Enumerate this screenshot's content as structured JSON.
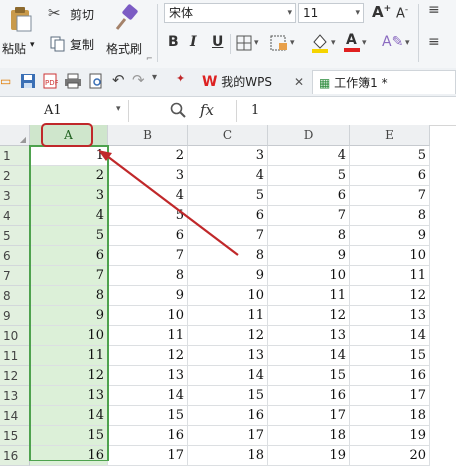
{
  "ribbon": {
    "cut_label": "剪切",
    "paste_label": "粘贴",
    "copy_label": "复制",
    "format_painter_label": "格式刷",
    "font_name": "宋体",
    "font_size": "11",
    "bold": "B",
    "italic": "I",
    "underline": "U"
  },
  "tabs": [
    {
      "label": "我的WPS"
    },
    {
      "label": "工作簿1 *"
    }
  ],
  "formula_bar": {
    "name_box": "A1",
    "fx_label": "fx",
    "value": "1"
  },
  "columns": [
    "A",
    "B",
    "C",
    "D",
    "E"
  ],
  "rows": [
    {
      "num": "1",
      "cells": [
        "1",
        "2",
        "3",
        "4",
        "5"
      ]
    },
    {
      "num": "2",
      "cells": [
        "2",
        "3",
        "4",
        "5",
        "6"
      ]
    },
    {
      "num": "3",
      "cells": [
        "3",
        "4",
        "5",
        "6",
        "7"
      ]
    },
    {
      "num": "4",
      "cells": [
        "4",
        "5",
        "6",
        "7",
        "8"
      ]
    },
    {
      "num": "5",
      "cells": [
        "5",
        "6",
        "7",
        "8",
        "9"
      ]
    },
    {
      "num": "6",
      "cells": [
        "6",
        "7",
        "8",
        "9",
        "10"
      ]
    },
    {
      "num": "7",
      "cells": [
        "7",
        "8",
        "9",
        "10",
        "11"
      ]
    },
    {
      "num": "8",
      "cells": [
        "8",
        "9",
        "10",
        "11",
        "12"
      ]
    },
    {
      "num": "9",
      "cells": [
        "9",
        "10",
        "11",
        "12",
        "13"
      ]
    },
    {
      "num": "10",
      "cells": [
        "10",
        "11",
        "12",
        "13",
        "14"
      ]
    },
    {
      "num": "11",
      "cells": [
        "11",
        "12",
        "13",
        "14",
        "15"
      ]
    },
    {
      "num": "12",
      "cells": [
        "12",
        "13",
        "14",
        "15",
        "16"
      ]
    },
    {
      "num": "13",
      "cells": [
        "13",
        "14",
        "15",
        "16",
        "17"
      ]
    },
    {
      "num": "14",
      "cells": [
        "14",
        "15",
        "16",
        "17",
        "18"
      ]
    },
    {
      "num": "15",
      "cells": [
        "15",
        "16",
        "17",
        "18",
        "19"
      ]
    },
    {
      "num": "16",
      "cells": [
        "16",
        "17",
        "18",
        "19",
        "20"
      ]
    }
  ],
  "colors": {
    "selection_fill": "#dcf0d8",
    "selection_border": "#4ea24e",
    "annotation_red": "#c0282a"
  }
}
